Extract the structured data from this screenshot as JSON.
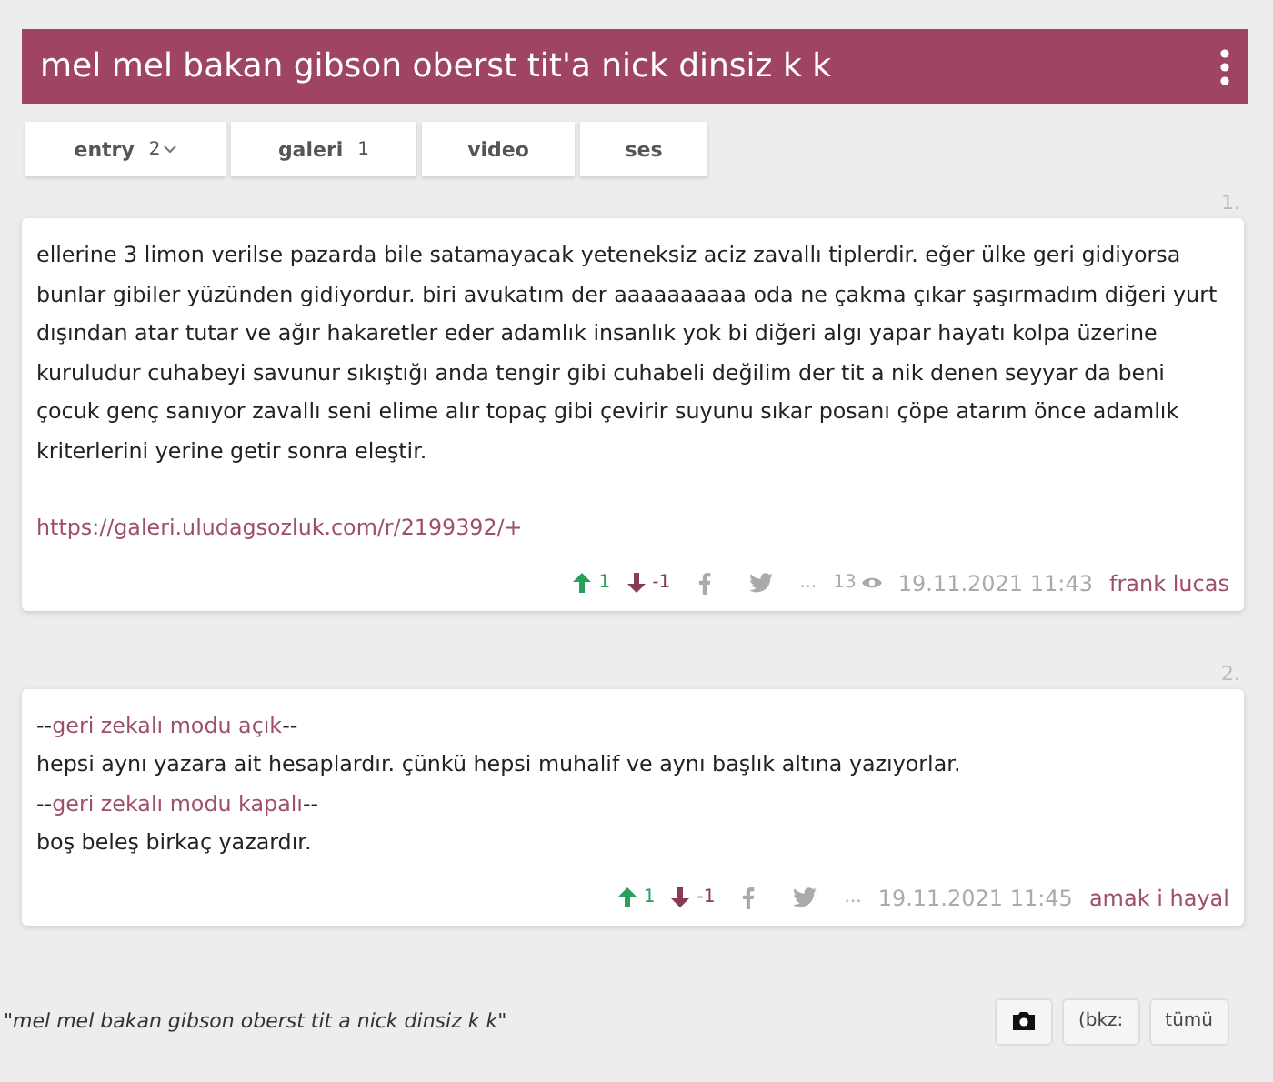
{
  "title": "mel mel bakan gibson oberst tit'a nick dinsiz k k",
  "tabs": [
    {
      "label": "entry",
      "count": "2",
      "caret": true
    },
    {
      "label": "galeri",
      "count": "1",
      "caret": false
    },
    {
      "label": "video"
    },
    {
      "label": "ses"
    }
  ],
  "entries": [
    {
      "number": "1.",
      "lines": [
        [
          {
            "kind": "text",
            "text": "ellerine 3 limon verilse pazarda bile satamayacak yeteneksiz aciz zavallı tiplerdir. eğer ülke geri gidiyorsa bunlar gibiler yüzünden gidiyordur. biri avukatım der aaaaaaaaaa oda ne çakma çıkar şaşırmadım diğeri yurt dışından atar tutar ve ağır hakaretler eder adamlık insanlık yok bi diğeri algı yapar hayatı kolpa üzerine kuruludur cuhabeyi savunur sıkıştığı anda tengir gibi cuhabeli değilim der tit a nik denen seyyar da beni çocuk genç sanıyor zavallı seni elime alır topaç gibi çevirir suyunu sıkar posanı çöpe atarım önce adamlık kriterlerini yerine getir sonra eleştir."
          }
        ],
        [
          {
            "kind": "link",
            "text": "https://galeri.uludagsozluk.com/r/2199392/+",
            "spaced": true
          }
        ]
      ],
      "up": "1",
      "down": "-1",
      "more": "...",
      "views": "13",
      "date": "19.11.2021 11:43",
      "author": "frank lucas"
    },
    {
      "number": "2.",
      "lines": [
        [
          {
            "kind": "text",
            "text": "--"
          },
          {
            "kind": "link",
            "text": "geri zekalı modu açık"
          },
          {
            "kind": "text",
            "text": "--"
          }
        ],
        [
          {
            "kind": "text",
            "text": "hepsi aynı yazara ait hesaplardır. çünkü hepsi muhalif ve aynı başlık altına yazıyorlar."
          }
        ],
        [
          {
            "kind": "text",
            "text": "--"
          },
          {
            "kind": "link",
            "text": "geri zekalı modu kapalı"
          },
          {
            "kind": "text",
            "text": "--"
          }
        ],
        [
          {
            "kind": "text",
            "text": "boş beleş birkaç yazardır."
          }
        ]
      ],
      "up": "1",
      "down": "-1",
      "more": "...",
      "date": "19.11.2021 11:45",
      "author": "amak i hayal"
    }
  ],
  "footer": {
    "quote": "\"mel mel bakan gibson oberst tit a nick dinsiz k k\"",
    "buttons": [
      {
        "kind": "icon"
      },
      {
        "kind": "text",
        "label": "(bkz:"
      },
      {
        "kind": "text",
        "label": "tümü"
      }
    ]
  }
}
